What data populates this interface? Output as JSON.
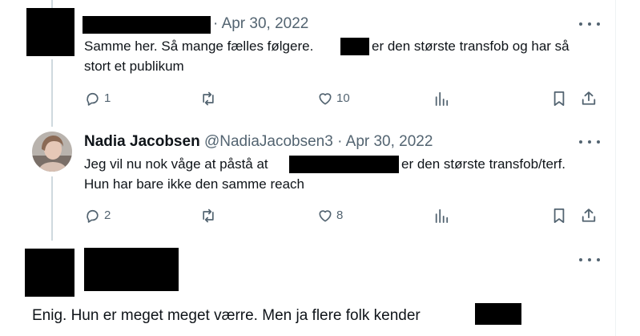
{
  "tweets": [
    {
      "time": "Apr 30, 2022",
      "separator": "·",
      "text_line1_part1": "Samme her. Så mange fælles følgere.",
      "text_line1_part2": "er den største transfob og har så",
      "text_line2": "stort et publikum",
      "replies": "1",
      "likes": "10"
    },
    {
      "name": "Nadia Jacobsen",
      "handle": "@NadiaJacobsen3",
      "separator": "·",
      "time": "Apr 30, 2022",
      "text_line1_part1": "Jeg vil nu nok våge at påstå at",
      "text_line1_part2": "er den største transfob/terf.",
      "text_line2": "Hun har bare ikke den samme reach",
      "replies": "2",
      "likes": "8"
    },
    {
      "text_part1": "Enig. Hun er meget meget værre. Men ja flere folk kender"
    }
  ],
  "icons": [
    "reply-icon",
    "retweet-icon",
    "like-icon",
    "views-icon",
    "bookmark-icon",
    "share-icon",
    "more-icon"
  ],
  "colors": {
    "icon": "#536471",
    "text": "#0f1419",
    "thread_line": "#cfd9de",
    "redaction": "#000000"
  }
}
